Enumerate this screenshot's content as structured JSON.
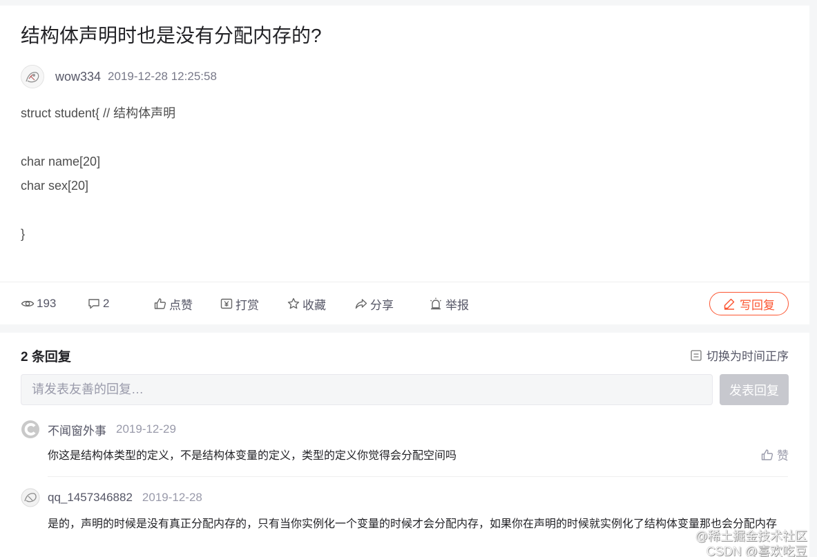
{
  "post": {
    "title": "结构体声明时也是没有分配内存的?",
    "author": "wow334",
    "time": "2019-12-28 12:25:58",
    "content_lines": [
      "struct student{ // 结构体声明",
      "",
      "char name[20]",
      "char sex[20]",
      "",
      "}"
    ]
  },
  "actions": {
    "views": "193",
    "comments": "2",
    "like": "点赞",
    "reward": "打赏",
    "collect": "收藏",
    "share": "分享",
    "report": "举报",
    "write_reply": "写回复"
  },
  "replies": {
    "count_label": "2 条回复",
    "sort_label": "切换为时间正序",
    "input_placeholder": "请发表友善的回复…",
    "submit_label": "发表回复",
    "items": [
      {
        "name": "不闻窗外事",
        "time": "2019-12-29",
        "text": "你这是结构体类型的定义，不是结构体变量的定义，类型的定义你觉得会分配空间吗",
        "like_label": "赞"
      },
      {
        "name": "qq_1457346882",
        "time": "2019-12-28",
        "text": "是的，声明的时候是没有真正分配内存的，只有当你实例化一个变量的时候才会分配内存，如果你在声明的时候就实例化了结构体变量那也会分配内存"
      }
    ]
  },
  "watermark": {
    "line1": "@稀土掘金技术社区",
    "line2": "CSDN @喜欢吃豆"
  },
  "colors": {
    "accent": "#fc5531",
    "muted": "#999aaa",
    "text": "#222226",
    "button_disabled": "#c7c8ce"
  }
}
